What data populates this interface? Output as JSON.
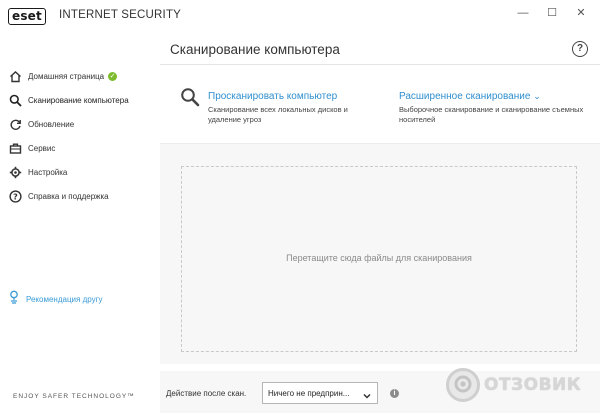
{
  "app": {
    "logo_text": "eset",
    "product_name": "INTERNET SECURITY",
    "window_controls": {
      "minimize": "—",
      "maximize": "☐",
      "close": "✕"
    }
  },
  "sidebar": {
    "items": [
      {
        "label": "Домашняя страница",
        "icon": "home-icon",
        "badge": "✓"
      },
      {
        "label": "Сканирование компьютера",
        "icon": "search-icon",
        "active": true
      },
      {
        "label": "Обновление",
        "icon": "refresh-icon"
      },
      {
        "label": "Сервис",
        "icon": "briefcase-icon"
      },
      {
        "label": "Настройка",
        "icon": "gear-icon"
      },
      {
        "label": "Справка и поддержка",
        "icon": "help-icon"
      }
    ],
    "recommend_label": "Рекомендация другу",
    "tagline": "ENJOY SAFER TECHNOLOGY™"
  },
  "main": {
    "title": "Сканирование компьютера",
    "help_symbol": "?",
    "scan": {
      "title": "Просканировать компьютер",
      "description": "Сканирование всех локальных дисков и удаление угроз"
    },
    "advanced": {
      "title": "Расширенное сканирование",
      "chevron": "⌄",
      "description": "Выборочное сканирование и сканирование съемных носителей"
    },
    "dropzone_text": "Перетащите сюда файлы для сканирования",
    "footer": {
      "after_scan_label": "Действие после скан.",
      "after_scan_value": "Ничего не предприн...",
      "info_symbol": "i"
    }
  },
  "watermark": {
    "text": "ОТЗОВИК"
  },
  "colors": {
    "accent": "#2f8fcf",
    "badge_green": "#7cbb2c",
    "link": "#3b9bd6"
  }
}
